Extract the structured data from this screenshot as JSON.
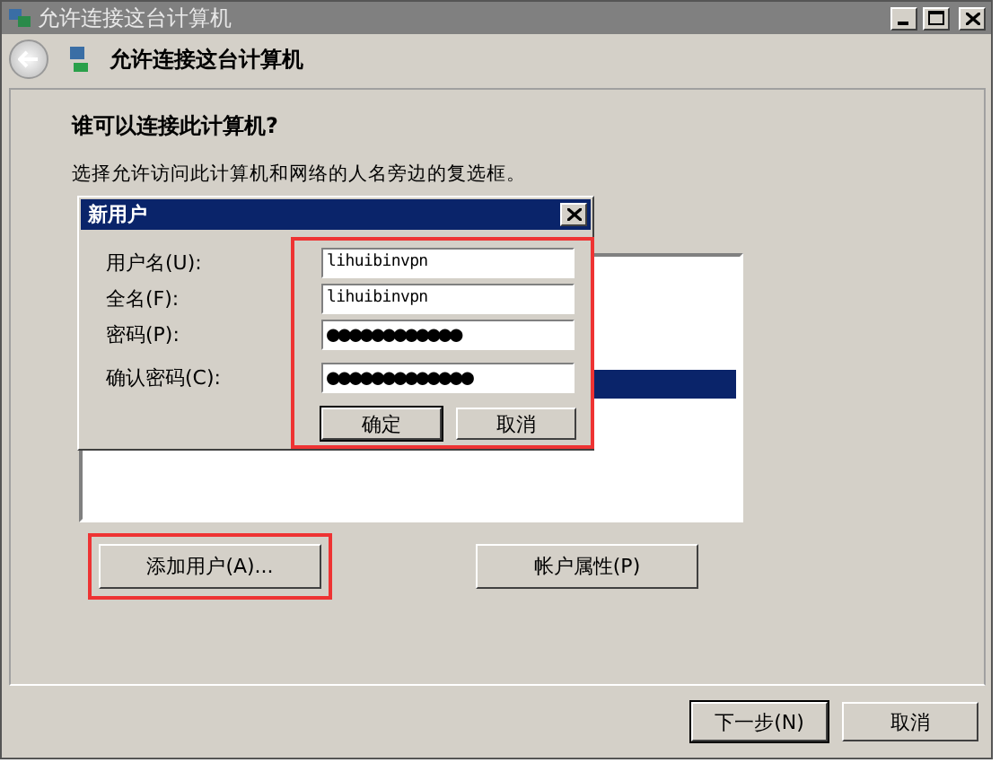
{
  "window": {
    "title": "允许连接这台计算机"
  },
  "nav": {
    "heading": "允许连接这台计算机"
  },
  "page": {
    "question": "谁可以连接此计算机?",
    "description": "选择允许访问此计算机和网络的人名旁边的复选框。"
  },
  "user_list": {
    "rows": [
      {
        "selected": true
      }
    ]
  },
  "buttons": [
    {
      "label": "添加用户(A)...",
      "highlighted": true
    },
    {
      "label": "帐户属性(P)",
      "highlighted": false
    }
  ],
  "footer_buttons": [
    {
      "label": "下一步(N)",
      "default": true
    },
    {
      "label": "取消",
      "default": false
    }
  ],
  "dialog": {
    "title": "新用户",
    "fields": [
      {
        "label": "用户名(U):",
        "value": "lihuibinvpn",
        "kind": "text"
      },
      {
        "label": "全名(F):",
        "value": "lihuibinvpn",
        "kind": "text"
      },
      {
        "label": "密码(P):",
        "value": "●●●●●●●●●●●●",
        "kind": "password"
      },
      {
        "label": "确认密码(C):",
        "value": "●●●●●●●●●●●●●",
        "kind": "password"
      }
    ],
    "buttons": [
      {
        "label": "确定",
        "default": true
      },
      {
        "label": "取消",
        "default": false
      }
    ]
  }
}
